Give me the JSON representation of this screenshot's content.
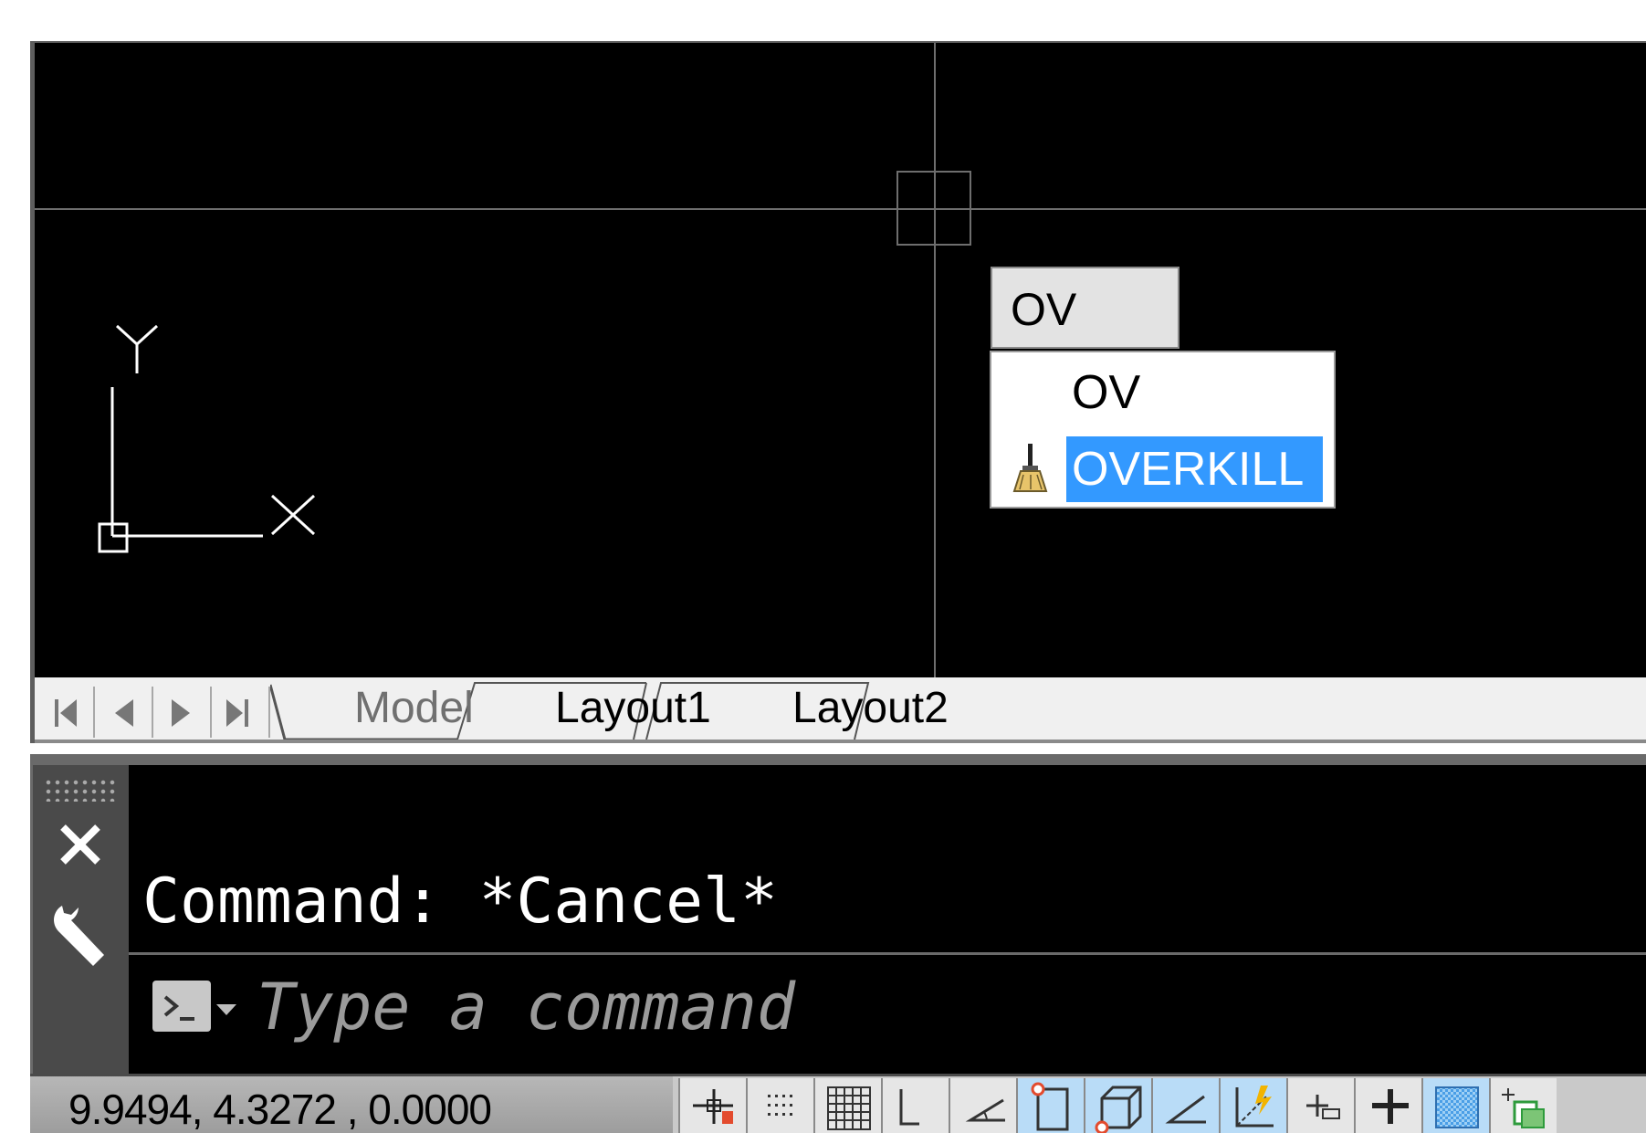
{
  "colors": {
    "canvas_bg": "#000000",
    "selection": "#3399ff",
    "status_on": "#b9dcf7"
  },
  "autocomplete": {
    "input_value": "OV",
    "items": [
      {
        "label": "OV",
        "icon": null,
        "selected": false
      },
      {
        "label": "OVERKILL",
        "icon": "broom-icon",
        "selected": true
      }
    ]
  },
  "ucs": {
    "x_label": "X",
    "y_label": "Y"
  },
  "layout_tabs": {
    "nav": [
      "first-tab-icon",
      "prev-tab-icon",
      "next-tab-icon",
      "last-tab-icon"
    ],
    "tabs": [
      {
        "label": "Model",
        "active": true
      },
      {
        "label": "Layout1",
        "active": false
      },
      {
        "label": "Layout2",
        "active": false
      }
    ]
  },
  "command_line": {
    "history": "Command: *Cancel*",
    "placeholder": "Type a command",
    "close_icon": "close-icon",
    "customize_icon": "wrench-icon"
  },
  "status_bar": {
    "coordinates": "9.9494, 4.3272 , 0.0000",
    "toggles": [
      {
        "name": "infer-constraints-icon",
        "on": false
      },
      {
        "name": "snap-mode-icon",
        "on": false
      },
      {
        "name": "grid-display-icon",
        "on": false
      },
      {
        "name": "ortho-mode-icon",
        "on": false
      },
      {
        "name": "polar-tracking-icon",
        "on": false
      },
      {
        "name": "object-snap-icon",
        "on": true
      },
      {
        "name": "3d-object-snap-icon",
        "on": true
      },
      {
        "name": "object-snap-tracking-icon",
        "on": true
      },
      {
        "name": "dynamic-ucs-icon",
        "on": true
      },
      {
        "name": "dynamic-input-icon",
        "on": false
      },
      {
        "name": "lineweight-icon",
        "on": false
      },
      {
        "name": "transparency-icon",
        "on": true
      },
      {
        "name": "selection-cycling-icon",
        "on": false
      }
    ]
  }
}
